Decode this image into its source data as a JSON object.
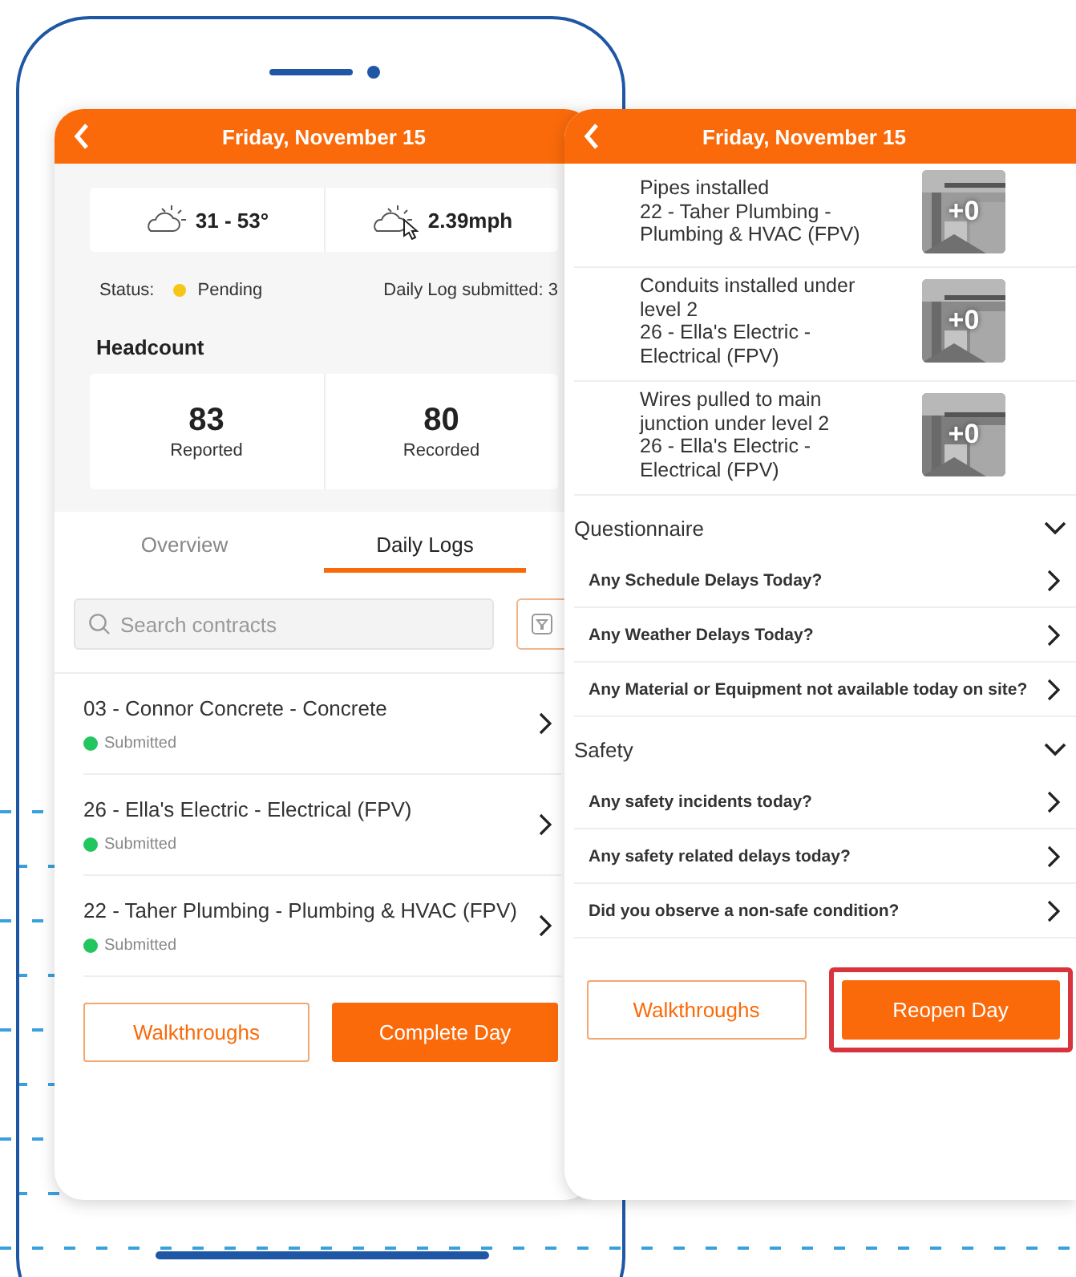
{
  "left_screen": {
    "header": {
      "title": "Friday, November 15"
    },
    "weather": [
      {
        "kind": "temperature",
        "value": "31 - 53°"
      },
      {
        "kind": "wind",
        "value": "2.39mph"
      }
    ],
    "status": {
      "label": "Status:",
      "value": "Pending",
      "color": "#f5c518"
    },
    "submitted": "Daily Log submitted: 3",
    "headcount": {
      "title": "Headcount",
      "stats": [
        {
          "value": "83",
          "label": "Reported"
        },
        {
          "value": "80",
          "label": "Recorded"
        }
      ]
    },
    "tabs": [
      {
        "label": "Overview",
        "selected": false
      },
      {
        "label": "Daily Logs",
        "selected": true
      }
    ],
    "search": {
      "placeholder": "Search contracts"
    },
    "contracts": [
      {
        "name": "03 - Connor Concrete - Concrete",
        "status": "Submitted",
        "color": "#22c55e"
      },
      {
        "name": "26 - Ella's Electric - Electrical (FPV)",
        "status": "Submitted",
        "color": "#22c55e"
      },
      {
        "name": "22 - Taher Plumbing - Plumbing & HVAC (FPV)",
        "status": "Submitted",
        "color": "#22c55e"
      }
    ],
    "buttons": [
      {
        "label": "Walkthroughs",
        "kind": "outline",
        "highlighted": false
      },
      {
        "label": "Complete Day",
        "kind": "primary",
        "highlighted": false
      }
    ]
  },
  "right_screen": {
    "header": {
      "title": "Friday, November 15"
    },
    "activities": [
      {
        "description": "Pipes installed",
        "contract": "22 - Taher Plumbing - Plumbing & HVAC (FPV)",
        "photo_count": "+0"
      },
      {
        "description": "Conduits installed under level 2",
        "contract": "26 - Ella's Electric - Electrical (FPV)",
        "photo_count": "+0"
      },
      {
        "description": "Wires pulled to main junction under level 2",
        "contract": "26 - Ella's Electric - Electrical (FPV)",
        "photo_count": "+0"
      }
    ],
    "sections": [
      {
        "title": "Questionnaire",
        "expanded": true,
        "items": [
          "Any Schedule Delays Today?",
          "Any Weather Delays Today?",
          "Any Material or Equipment not available today on site?"
        ]
      },
      {
        "title": "Safety",
        "expanded": true,
        "items": [
          "Any safety incidents today?",
          "Any safety related delays today?",
          "Did you observe a non-safe condition?"
        ]
      }
    ],
    "buttons": [
      {
        "label": "Walkthroughs",
        "kind": "outline",
        "highlighted": false
      },
      {
        "label": "Reopen Day",
        "kind": "primary",
        "highlighted": true
      }
    ]
  }
}
